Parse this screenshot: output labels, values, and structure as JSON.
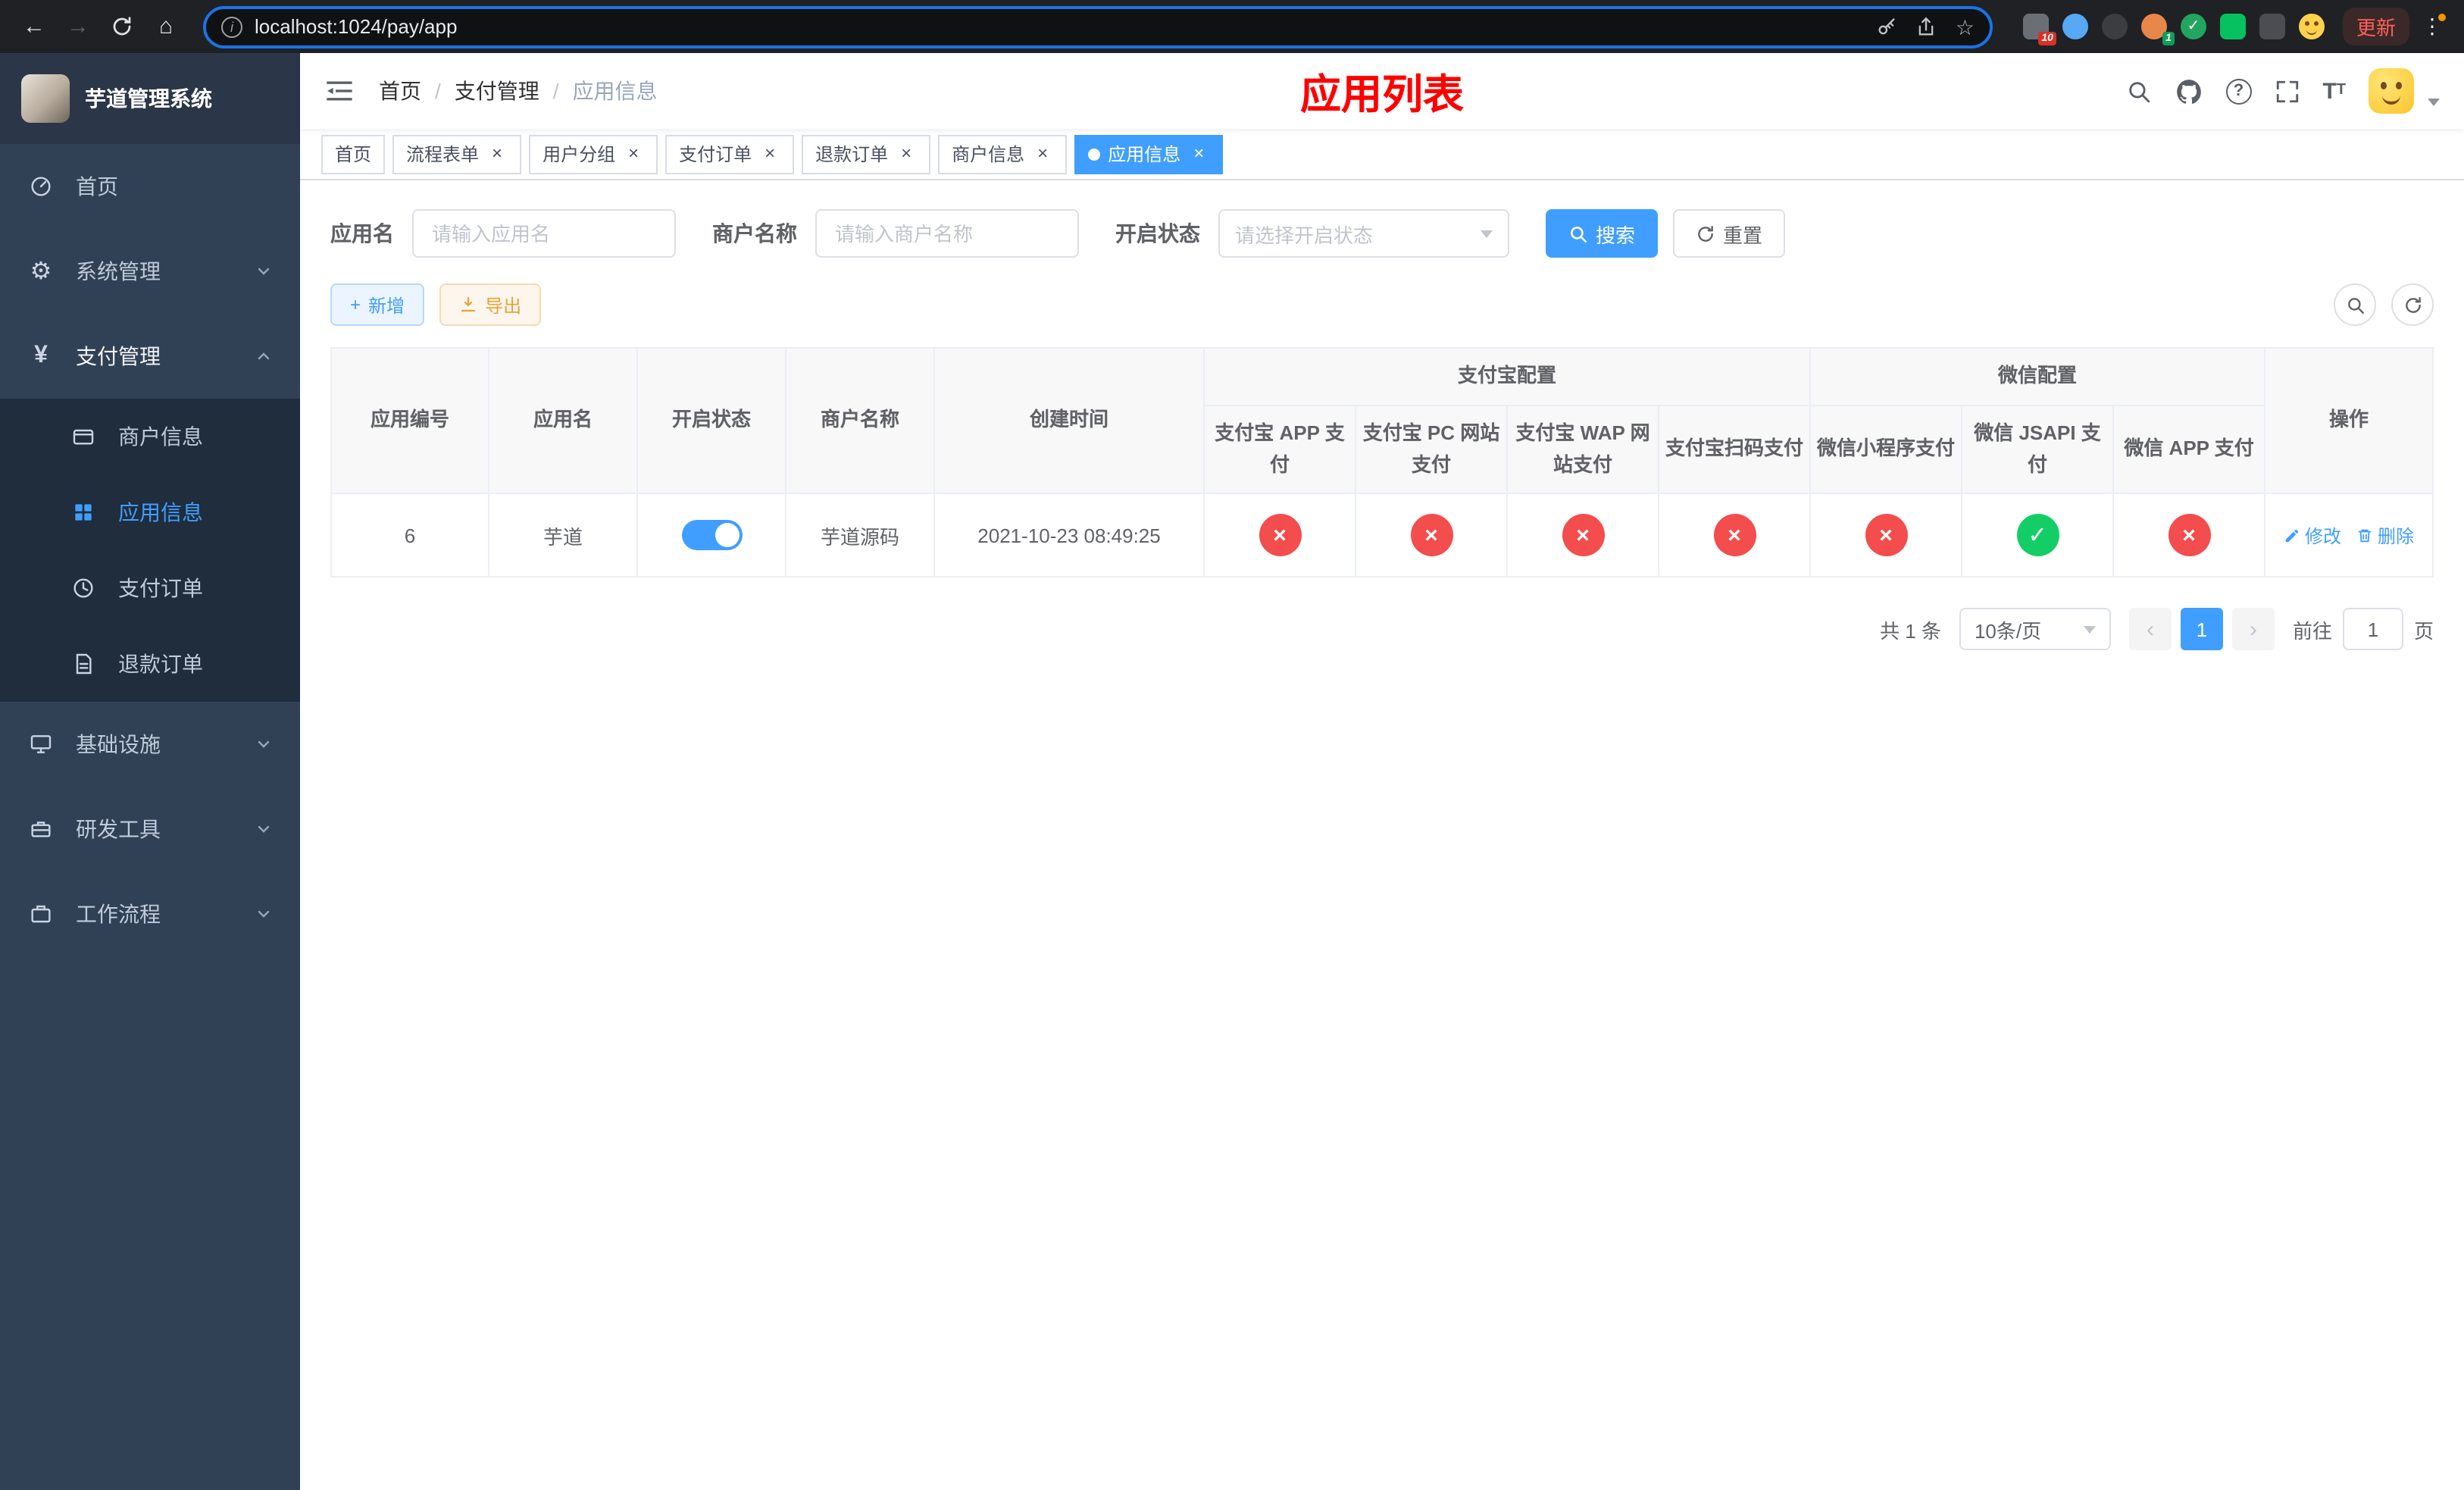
{
  "browser": {
    "url": "localhost:1024/pay/app",
    "update_button": "更新",
    "pin_badge": "10",
    "avatar_badge": "1"
  },
  "sidebar": {
    "app_title": "芋道管理系统",
    "menu": [
      {
        "label": "首页"
      },
      {
        "label": "系统管理"
      },
      {
        "label": "支付管理"
      },
      {
        "label": "基础设施"
      },
      {
        "label": "研发工具"
      },
      {
        "label": "工作流程"
      }
    ],
    "pay_submenu": [
      {
        "label": "商户信息"
      },
      {
        "label": "应用信息"
      },
      {
        "label": "支付订单"
      },
      {
        "label": "退款订单"
      }
    ]
  },
  "header": {
    "breadcrumb": [
      {
        "label": "首页"
      },
      {
        "label": "支付管理"
      },
      {
        "label": "应用信息"
      }
    ],
    "page_title": "应用列表"
  },
  "tabs": [
    {
      "label": "首页"
    },
    {
      "label": "流程表单"
    },
    {
      "label": "用户分组"
    },
    {
      "label": "支付订单"
    },
    {
      "label": "退款订单"
    },
    {
      "label": "商户信息"
    },
    {
      "label": "应用信息"
    }
  ],
  "filters": {
    "app_name_label": "应用名",
    "app_name_placeholder": "请输入应用名",
    "merchant_label": "商户名称",
    "merchant_placeholder": "请输入商户名称",
    "status_label": "开启状态",
    "status_placeholder": "请选择开启状态",
    "search_button": "搜索",
    "reset_button": "重置"
  },
  "toolbar": {
    "add_button": "新增",
    "export_button": "导出"
  },
  "table": {
    "headers": {
      "app_id": "应用编号",
      "app_name": "应用名",
      "status": "开启状态",
      "merchant": "商户名称",
      "created": "创建时间",
      "alipay_group": "支付宝配置",
      "wechat_group": "微信配置",
      "alipay_app": "支付宝 APP 支付",
      "alipay_pc": "支付宝 PC 网站支付",
      "alipay_wap": "支付宝 WAP 网站支付",
      "alipay_qr": "支付宝扫码支付",
      "wechat_mini": "微信小程序支付",
      "wechat_jsapi": "微信 JSAPI 支付",
      "wechat_app": "微信 APP 支付",
      "actions": "操作"
    },
    "rows": [
      {
        "app_id": "6",
        "app_name": "芋道",
        "status_on": true,
        "merchant": "芋道源码",
        "created": "2021-10-23 08:49:25",
        "alipay_app": false,
        "alipay_pc": false,
        "alipay_wap": false,
        "alipay_qr": false,
        "wechat_mini": false,
        "wechat_jsapi": true,
        "wechat_app": false,
        "edit_label": "修改",
        "delete_label": "删除"
      }
    ]
  },
  "pagination": {
    "total": "共 1 条",
    "page_size": "10条/页",
    "page": "1",
    "goto_label": "前往",
    "goto_value": "1",
    "goto_suffix": "页"
  },
  "colors": {
    "accent": "#409eff",
    "success": "#13ce66",
    "danger": "#f34d4d",
    "sidebar_bg": "#304156",
    "title_red": "#ff0000"
  }
}
